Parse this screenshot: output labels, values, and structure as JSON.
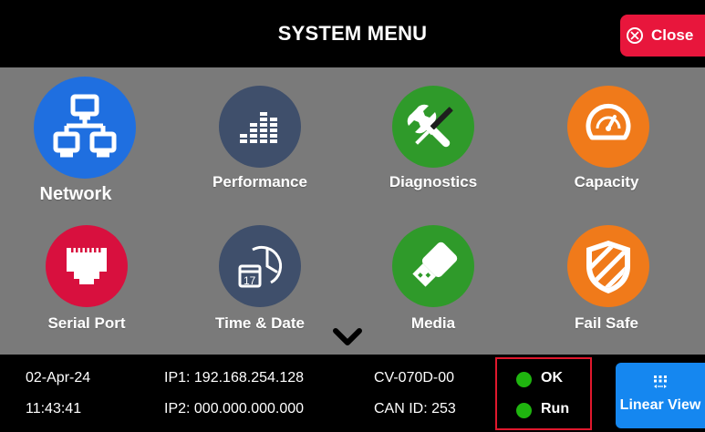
{
  "header": {
    "title": "SYSTEM MENU",
    "close_label": "Close"
  },
  "menu": {
    "network": "Network",
    "performance": "Performance",
    "diagnostics": "Diagnostics",
    "capacity": "Capacity",
    "serial_port": "Serial Port",
    "time_date": "Time & Date",
    "calendar_day": "17",
    "media": "Media",
    "fail_safe": "Fail Safe"
  },
  "status": {
    "date": "02-Apr-24",
    "time": "11:43:41",
    "ip1": "IP1: 192.168.254.128",
    "ip2": "IP2: 000.000.000.000",
    "model": "CV-070D-00",
    "can_id": "CAN ID: 253",
    "ok": "OK",
    "run": "Run",
    "linear_view": "Linear View"
  },
  "colors": {
    "close_red": "#e8163c",
    "network_blue": "#1f6fe0",
    "slate": "#3f4f6b",
    "green": "#2f9a2a",
    "orange": "#f07a1a",
    "serial_red": "#d8103e",
    "led_green": "#1fb50f",
    "linear_blue": "#1587f0",
    "panel_gray": "#7a7a7a"
  },
  "icons": [
    "close-icon",
    "network-icon",
    "performance-icon",
    "diagnostics-icon",
    "capacity-icon",
    "serial-port-icon",
    "time-date-icon",
    "media-icon",
    "fail-safe-icon",
    "chevron-down-icon",
    "linear-view-icon"
  ]
}
